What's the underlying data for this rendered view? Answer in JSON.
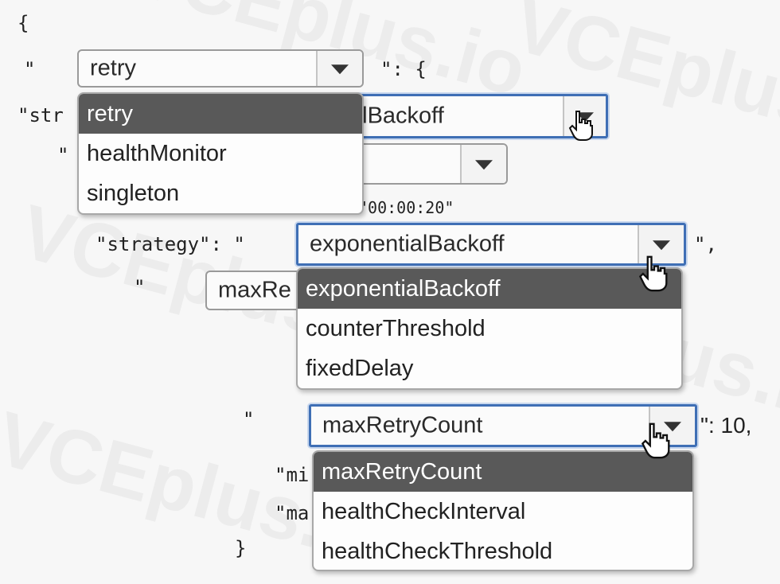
{
  "code": {
    "open_brace": "{",
    "line1_quote": "\"",
    "line1_suffix": "\": {",
    "line2_prefix": "\"str",
    "line3_prefix": "\"",
    "line4_fragment": "\"00:00:20\"",
    "strategy_label": "\"strategy\": \"",
    "strategy_suffix": "\",",
    "line6_quote": "\"",
    "maxre_fragment": "maxRe",
    "maxretry_quote": "\"",
    "maxretry_suffix": "\": 10,",
    "line9_prefix": "\"mi",
    "line10_prefix": "\"ma",
    "close_brace": "}"
  },
  "selects": {
    "rule_type": {
      "value": "retry",
      "options": [
        "retry",
        "healthMonitor",
        "singleton"
      ]
    },
    "strategy_top": {
      "value_fragment": "alBackoff"
    },
    "strategy": {
      "value": "exponentialBackoff",
      "options": [
        "exponentialBackoff",
        "counterThreshold",
        "fixedDelay"
      ]
    },
    "max_retry": {
      "value": "maxRetryCount",
      "options": [
        "maxRetryCount",
        "healthCheckInterval",
        "healthCheckThreshold"
      ]
    }
  },
  "watermark": "VCEplus.io",
  "colors": {
    "selected_option_bg": "#595959",
    "focus_border": "#3f6fb5"
  }
}
